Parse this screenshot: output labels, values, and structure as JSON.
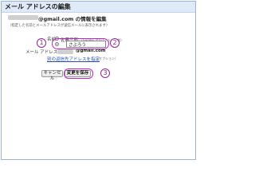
{
  "window": {
    "title": "メール アドレスの編集"
  },
  "header": {
    "email_domain_heading": "@gmail.com の情報を編集",
    "note": "（指定した名前とメールアドレスが送信メールに表示されます）"
  },
  "form": {
    "name_label": "名前:",
    "name_option_default": "佐藤三郎",
    "name_option_default_sub": "（Google アカウントの名前）",
    "name_custom_value": "さぶろう",
    "email_label": "メール アドレス:",
    "email_value_suffix": "@gmail.com",
    "reply_to_link": "別の返信先アドレスを指定",
    "reply_to_optional": "（オプション）"
  },
  "buttons": {
    "cancel": "キャンセル",
    "save": "変更を保存"
  },
  "annotations": {
    "marker1": "1",
    "marker2": "2",
    "marker3": "3",
    "color": "#c026c8"
  }
}
